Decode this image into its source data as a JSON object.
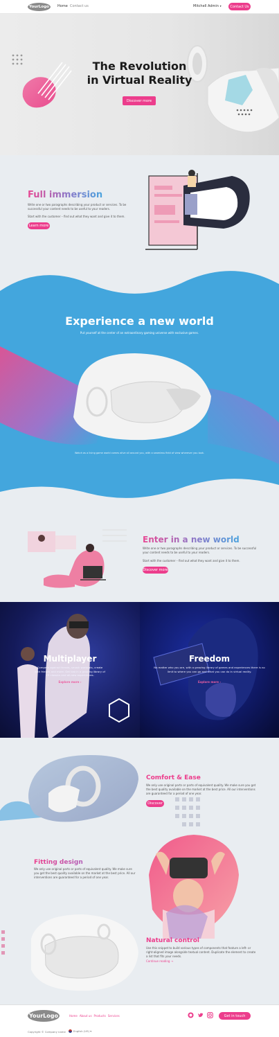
{
  "header": {
    "logo_text": "YourLogo",
    "nav": [
      "Home",
      "Contact us"
    ],
    "user": "Mitchell Admin",
    "cta": "Contact Us"
  },
  "hero": {
    "title_line1": "The Revolution",
    "title_line2": "in Virtual Reality",
    "button": "Discover more"
  },
  "immersion": {
    "title": "Full immersion",
    "text1": "Write one or two paragraphs describing your product or services. To be successful your content needs to be useful to your readers.",
    "text2": "Start with the customer – find out what they want and give it to them.",
    "button": "Learn more"
  },
  "experience": {
    "title": "Experience a new world",
    "subtitle": "Put yourself at the center of an extraordinary gaming universe with exclusive games.",
    "caption": "Watch as a living game world comes alive all around you, with a seamless field of view wherever you look."
  },
  "enter": {
    "title": "Enter in a new world",
    "text1": "Write one or two paragraphs describing your product or services. To be successful your content needs to be useful to your readers.",
    "text2": "Start with the customer – find out what they want and give it to them.",
    "button": "Discover more"
  },
  "split": {
    "left": {
      "title": "Multiplayer",
      "text": "Compete against friends, smash workouts, create with friends and more. Get lost in a growing library of VR classics and all-new experiences.",
      "link": "Explore more ›"
    },
    "right": {
      "title": "Freedom",
      "text": "No matter who you are, with a growing library of games and experiences there is no limit to where you can go and what you can do in virtual reality.",
      "link": "Explore more ›"
    }
  },
  "features": [
    {
      "title": "Comfort & Ease",
      "text": "We only use original parts or parts of equivalent quality. We make sure you get the best quality available on the market at the best price. All our interventions are guaranteed for a period of one year.",
      "button": "Discover"
    },
    {
      "title": "Fitting design",
      "text": "We only use original parts or parts of equivalent quality. We make sure you get the best quality available on the market at the best price. All our interventions are guaranteed for a period of one year."
    },
    {
      "title": "Natural control",
      "text": "Use this snippet to build various types of components that feature a left- or right-aligned image alongside textual content. Duplicate the element to create a list that fits your needs.",
      "link": "Continue reading →"
    }
  ],
  "footer": {
    "logo_text": "YourLogo",
    "links": [
      "Home",
      "About us",
      "Products",
      "Services"
    ],
    "social_icons": [
      "github-icon",
      "twitter-icon",
      "instagram-icon"
    ],
    "cta": "Get in touch",
    "copyright": "Copyright © Company name",
    "language": "English (US) ▾"
  },
  "colors": {
    "accent": "#ec3d8c",
    "blue": "#43a6dd",
    "dark_navy": "#0d1b4a",
    "background": "#e9edf1"
  }
}
